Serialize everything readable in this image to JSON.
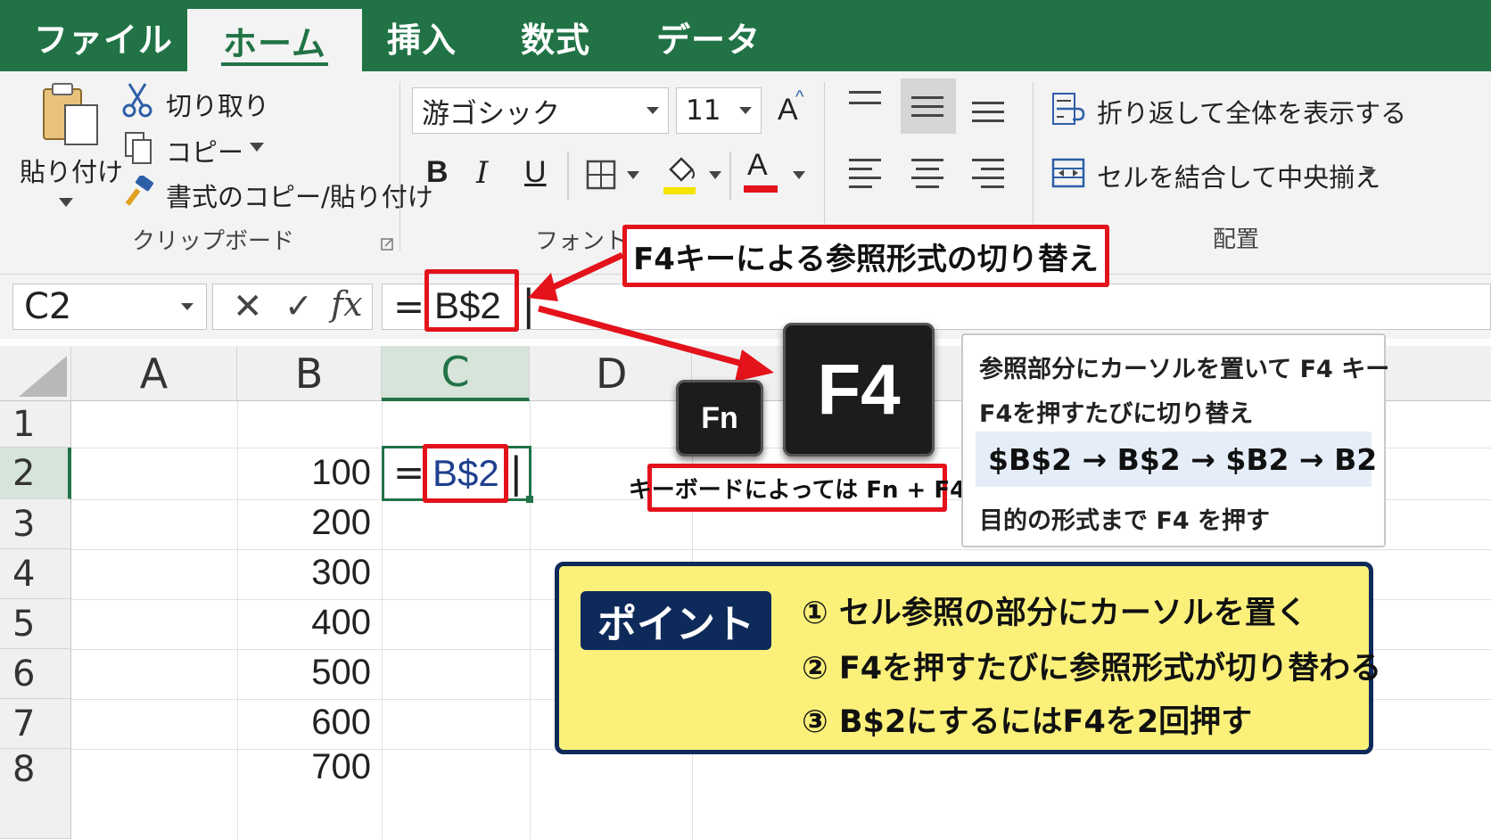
{
  "tabs": [
    "ファイル",
    "ホーム",
    "挿入",
    "数式",
    "データ"
  ],
  "clipboard": {
    "paste_label": "貼り付け",
    "cut_label": "切り取り",
    "copy_label": "コピー",
    "format_painter_label": "書式のコピー/貼り付け",
    "group_label": "クリップボード"
  },
  "font": {
    "font_name": "游ゴシック",
    "font_size": "11",
    "bold": "B",
    "italic": "I",
    "underline": "U",
    "font_color_glyph": "A",
    "grow_glyph": "A",
    "group_label": "フォント",
    "fill_color": "#f4e400",
    "font_color": "#e3121b"
  },
  "alignment": {
    "wrap_text_label": "折り返して全体を表示する",
    "merge_center_label": "セルを結合して中央揃え",
    "group_label": "配置"
  },
  "formula_bar": {
    "name_box": "C2",
    "cancel_glyph": "✕",
    "enter_glyph": "✓",
    "fx_glyph": "fx",
    "equals": "=",
    "formula_ref": "B$2",
    "cursor": "|"
  },
  "grid": {
    "columns": [
      "A",
      "B",
      "C",
      "D"
    ],
    "rows": [
      "1",
      "2",
      "3",
      "4",
      "5",
      "6",
      "7",
      "8"
    ],
    "b_values": [
      "",
      "100",
      "200",
      "300",
      "400",
      "500",
      "600",
      "700"
    ],
    "c2_equals": "=",
    "c2_ref": "B$2",
    "c2_cursor": "|"
  },
  "annotations": {
    "title_callout": "F4キーによる参照形式の切り替え",
    "key_fn": "Fn",
    "key_f4": "F4",
    "keyboard_note": "キーボードによっては Fn + F4",
    "info_line1": "参照部分にカーソルを置いて F4 キー",
    "info_line2": "F4を押すたびに切り替え",
    "info_sequence": "$B$2 → B$2 → $B2 → B2",
    "info_line3": "目的の形式まで F4 を押す",
    "point_badge": "ポイント",
    "point_1": "① セル参照の部分にカーソルを置く",
    "point_2": "② F4を押すたびに参照形式が切り替わる",
    "point_3": "③ B$2にするにはF4を2回押す"
  },
  "colors": {
    "excel_green": "#217346",
    "annotation_red": "#e3121b",
    "point_navy": "#0e2a5a",
    "point_yellow": "#fbf17a"
  }
}
